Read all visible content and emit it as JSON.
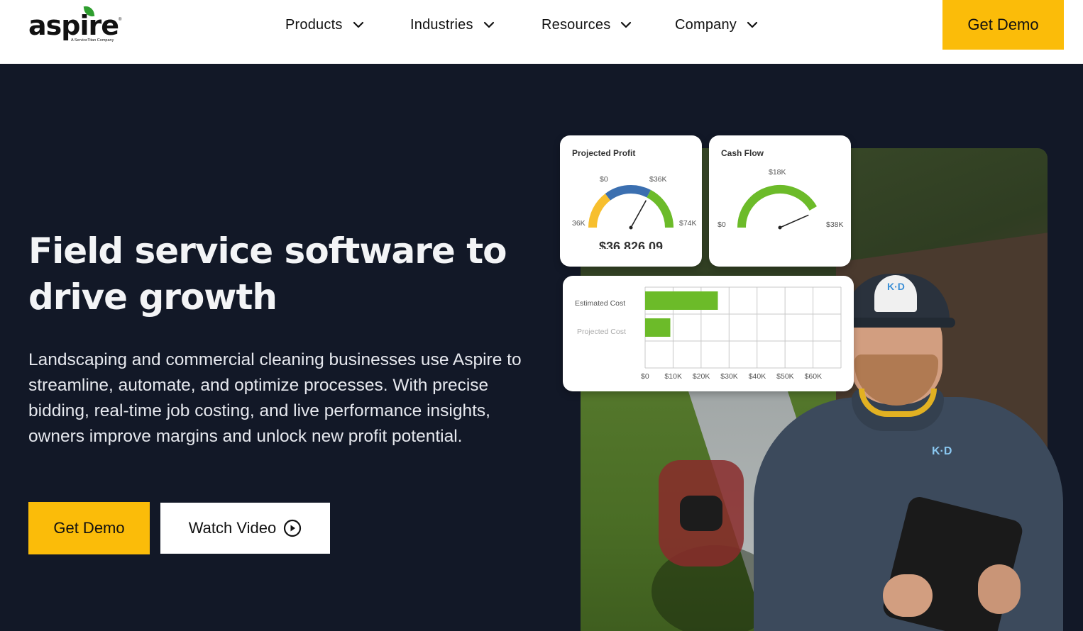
{
  "brand": {
    "name": "aspire",
    "trademark": "®",
    "tagline": "A ServiceTitan Company",
    "leaf_color": "#2f9e2f"
  },
  "nav": {
    "items": [
      {
        "label": "Products",
        "icon": "chevron-down-icon"
      },
      {
        "label": "Industries",
        "icon": "chevron-down-icon"
      },
      {
        "label": "Resources",
        "icon": "chevron-down-icon"
      },
      {
        "label": "Company",
        "icon": "chevron-down-icon"
      }
    ],
    "cta": "Get Demo"
  },
  "hero": {
    "title": "Field service software to drive growth",
    "description": "Landscaping and commercial cleaning businesses use Aspire to streamline, automate, and optimize processes. With precise bidding, real-time job costing, and live performance insights, owners improve margins and unlock new profit potential.",
    "primary_button": "Get Demo",
    "secondary_button": "Watch Video",
    "secondary_icon": "play-circle-icon"
  },
  "colors": {
    "accent": "#fbbc09",
    "background": "#121827",
    "gauge_yellow": "#f7bf2e",
    "gauge_blue": "#3b6fb0",
    "gauge_green": "#6cbb29"
  },
  "photo": {
    "cap_logo": "K·D",
    "shirt_logo": "K·D"
  },
  "chart_data": [
    {
      "type": "gauge",
      "title": "Projected Profit",
      "labels": {
        "left": "36K",
        "top_left": "$0",
        "top_right": "$36K",
        "right": "$74K"
      },
      "value_text": "$36,826.09",
      "range": [
        -36000,
        74000
      ],
      "value": 36826.09
    },
    {
      "type": "gauge",
      "title": "Cash Flow",
      "labels": {
        "left": "$0",
        "top": "$18K",
        "right": "$38K"
      },
      "range": [
        0,
        38000
      ],
      "value": 33000
    },
    {
      "type": "bar",
      "orientation": "horizontal",
      "categories": [
        "Estimated Cost",
        "Projected Cost"
      ],
      "values": [
        26000,
        9000
      ],
      "x_ticks": [
        "$0",
        "$10K",
        "$20K",
        "$30K",
        "$40K",
        "$50K",
        "$60K"
      ],
      "xlim": [
        0,
        70000
      ],
      "bar_color": "#6cbb29"
    }
  ]
}
